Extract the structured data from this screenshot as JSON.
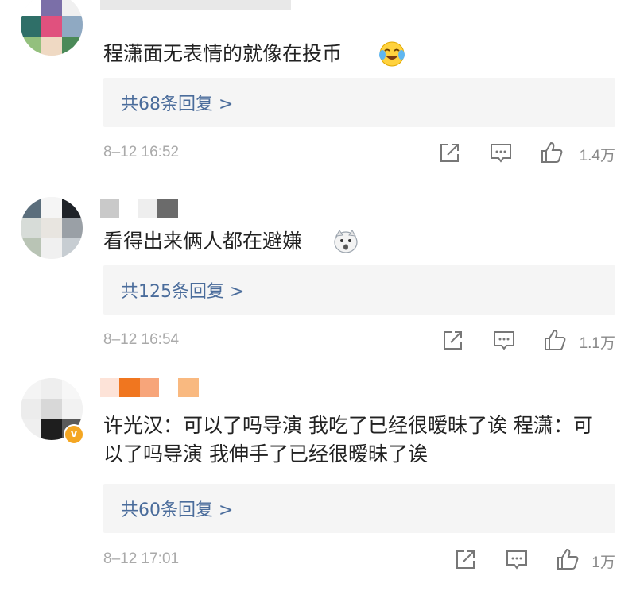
{
  "comments": [
    {
      "text": "程潇面无表情的就像在投币",
      "emoji": "laughing-crying-emoji",
      "replies_label": "共68条回复 >",
      "time": "8–12 16:52",
      "likes": "1.4万"
    },
    {
      "text": "看得出来俩人都在避嫌",
      "emoji": "shocked-doge-emoji",
      "replies_label": "共125条回复 >",
      "time": "8–12 16:54",
      "likes": "1.1万"
    },
    {
      "text": "许光汉：可以了吗导演 我吃了已经很暧昧了诶 程潇：可以了吗导演 我伸手了已经很暧昧了诶",
      "verified": true,
      "replies_label": "共60条回复 >",
      "time": "8–12 17:01",
      "likes": "1万"
    }
  ],
  "icons": {
    "share": "share-icon",
    "comment": "comment-icon",
    "like": "thumbs-up-icon",
    "verified": "verified-v-badge"
  },
  "colors": {
    "reply_link": "#4a6c9b",
    "reply_bg": "#f5f5f5",
    "meta_gray": "#aaaaaa",
    "verified_badge": "#f4a622"
  }
}
